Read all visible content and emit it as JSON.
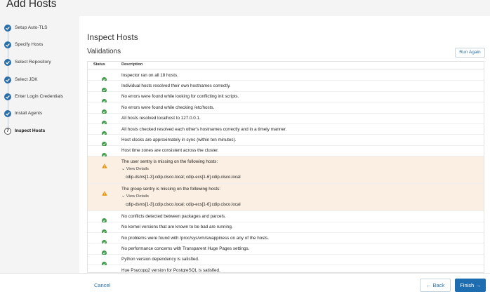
{
  "header": {
    "title": "Add Hosts"
  },
  "steps": [
    {
      "label": "Setup Auto-TLS",
      "state": "done"
    },
    {
      "label": "Specify Hosts",
      "state": "done"
    },
    {
      "label": "Select Repository",
      "state": "done"
    },
    {
      "label": "Select JDK",
      "state": "done"
    },
    {
      "label": "Enter Login Credentials",
      "state": "done"
    },
    {
      "label": "Install Agents",
      "state": "done"
    },
    {
      "label": "Inspect Hosts",
      "state": "current",
      "number": "7"
    }
  ],
  "main": {
    "title": "Inspect Hosts",
    "subtitle": "Validations",
    "run_again": "Run Again"
  },
  "table": {
    "col_status": "Status",
    "col_description": "Description",
    "view_details": "View Details",
    "rows": [
      {
        "status": "ok",
        "text": "Inspector ran on all 18 hosts."
      },
      {
        "status": "ok",
        "text": "Individual hosts resolved their own hostnames correctly."
      },
      {
        "status": "ok",
        "text": "No errors were found while looking for conflicting init scripts."
      },
      {
        "status": "ok",
        "text": "No errors were found while checking /etc/hosts."
      },
      {
        "status": "ok",
        "text": "All hosts resolved localhost to 127.0.0.1."
      },
      {
        "status": "ok",
        "text": "All hosts checked resolved each other's hostnames correctly and in a timely manner."
      },
      {
        "status": "ok",
        "text": "Host clocks are approximately in sync (within ten minutes)."
      },
      {
        "status": "ok",
        "text": "Host time zones are consistent across the cluster."
      },
      {
        "status": "warning",
        "text": "The user sentry is missing on the following hosts:",
        "detail": "cdip-dsms[1-3].cdip.cisco.local; cdip-ecs[1-6].cdip.cisco.local"
      },
      {
        "status": "warning",
        "text": "The group sentry is missing on the following hosts:",
        "detail": "cdip-dsms[1-3].cdip.cisco.local; cdip-ecs[1-6].cdip.cisco.local"
      },
      {
        "status": "ok",
        "text": "No conflicts detected between packages and parcels."
      },
      {
        "status": "ok",
        "text": "No kernel versions that are known to be bad are running."
      },
      {
        "status": "ok",
        "text": "No problems were found with /proc/sys/vm/swappiness on any of the hosts."
      },
      {
        "status": "ok",
        "text": "No performance concerns with Transparent Huge Pages settings."
      },
      {
        "status": "ok",
        "text": "Python version dependency is satisfied."
      },
      {
        "status": "ok",
        "text": "Hue Psycopg2 version for PostgreSQL is satisfied."
      }
    ]
  },
  "footer": {
    "cancel": "Cancel",
    "back": "← Back",
    "finish": "Finish →"
  },
  "colors": {
    "accent": "#1f6db1",
    "ok": "#3c9a45",
    "warning": "#e69100",
    "warning_row": "#fbeee2"
  }
}
